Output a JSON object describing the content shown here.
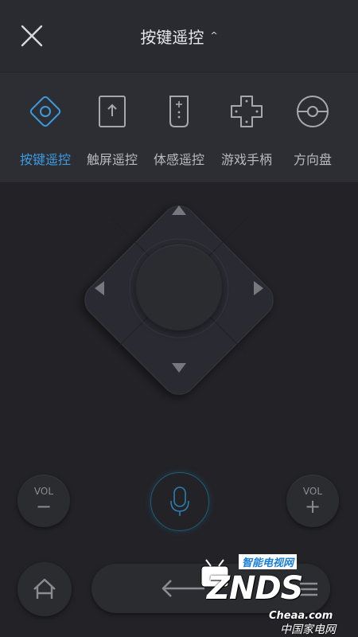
{
  "header": {
    "title": "按键遥控",
    "caret": "^"
  },
  "modes": [
    {
      "label": "按键遥控",
      "icon": "dpad-diamond-icon",
      "active": true
    },
    {
      "label": "触屏遥控",
      "icon": "touchscreen-icon",
      "active": false
    },
    {
      "label": "体感遥控",
      "icon": "motion-remote-icon",
      "active": false
    },
    {
      "label": "游戏手柄",
      "icon": "gamepad-icon",
      "active": false
    },
    {
      "label": "方向盘",
      "icon": "steering-wheel-icon",
      "active": false
    }
  ],
  "controls": {
    "vol_label": "VOL",
    "vol_minus": "−",
    "vol_plus": "+"
  },
  "watermark": {
    "top": "智能电视网",
    "brand": "ZNDS",
    "site": "Cheaa.com",
    "cn": "中国家电网"
  },
  "colors": {
    "accent": "#3d9be0",
    "background": "#232327",
    "panel": "#2d2e33"
  }
}
